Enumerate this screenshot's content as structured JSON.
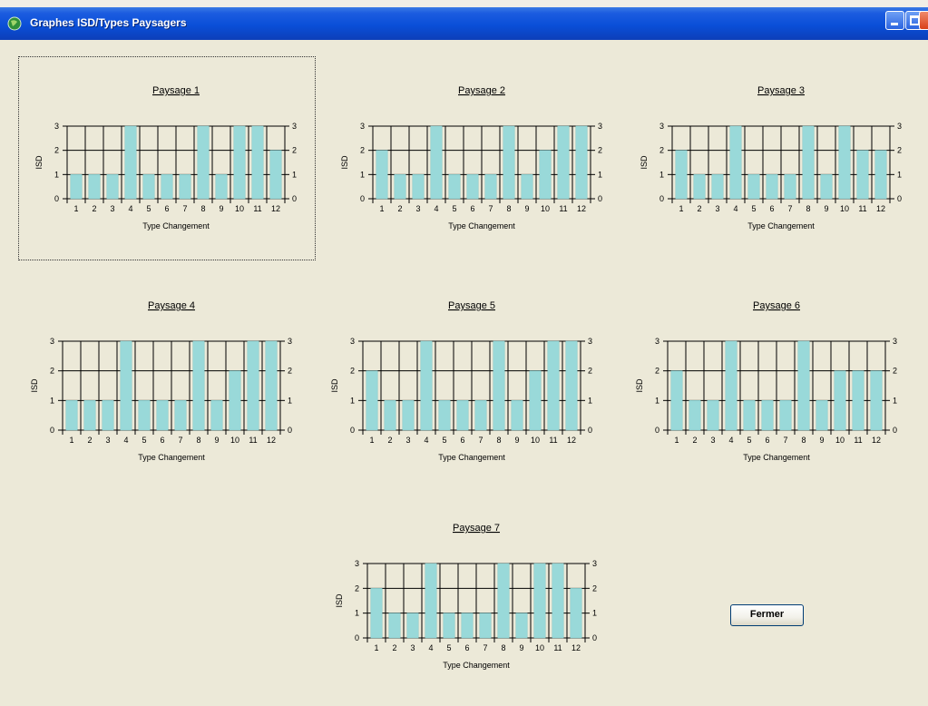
{
  "window": {
    "title": "Graphes ISD/Types Paysagers"
  },
  "buttons": {
    "close_label": "Fermer"
  },
  "colors": {
    "bar": "#99d9d9",
    "bar_edge": "#7fc6c6",
    "titlebar": "#0a4fd8",
    "background": "#ece9d8"
  },
  "chart_data": [
    {
      "type": "bar",
      "title": "Paysage 1",
      "xlabel": "Type Changement",
      "ylabel": "ISD",
      "categories": [
        "1",
        "2",
        "3",
        "4",
        "5",
        "6",
        "7",
        "8",
        "9",
        "10",
        "11",
        "12"
      ],
      "values": [
        1,
        1,
        1,
        3,
        1,
        1,
        1,
        3,
        1,
        3,
        3,
        2
      ],
      "ylim": [
        0,
        3
      ],
      "yticks": [
        0,
        1,
        2,
        3
      ],
      "grid": true,
      "secondary_axis": "right"
    },
    {
      "type": "bar",
      "title": "Paysage 2",
      "xlabel": "Type Changement",
      "ylabel": "ISD",
      "categories": [
        "1",
        "2",
        "3",
        "4",
        "5",
        "6",
        "7",
        "8",
        "9",
        "10",
        "11",
        "12"
      ],
      "values": [
        2,
        1,
        1,
        3,
        1,
        1,
        1,
        3,
        1,
        2,
        3,
        3
      ],
      "ylim": [
        0,
        3
      ],
      "yticks": [
        0,
        1,
        2,
        3
      ],
      "grid": true,
      "secondary_axis": "right"
    },
    {
      "type": "bar",
      "title": "Paysage 3",
      "xlabel": "Type Changement",
      "ylabel": "ISD",
      "categories": [
        "1",
        "2",
        "3",
        "4",
        "5",
        "6",
        "7",
        "8",
        "9",
        "10",
        "11",
        "12"
      ],
      "values": [
        2,
        1,
        1,
        3,
        1,
        1,
        1,
        3,
        1,
        3,
        2,
        2
      ],
      "ylim": [
        0,
        3
      ],
      "yticks": [
        0,
        1,
        2,
        3
      ],
      "grid": true,
      "secondary_axis": "right"
    },
    {
      "type": "bar",
      "title": "Paysage 4",
      "xlabel": "Type Changement",
      "ylabel": "ISD",
      "categories": [
        "1",
        "2",
        "3",
        "4",
        "5",
        "6",
        "7",
        "8",
        "9",
        "10",
        "11",
        "12"
      ],
      "values": [
        1,
        1,
        1,
        3,
        1,
        1,
        1,
        3,
        1,
        2,
        3,
        3
      ],
      "ylim": [
        0,
        3
      ],
      "yticks": [
        0,
        1,
        2,
        3
      ],
      "grid": true,
      "secondary_axis": "right"
    },
    {
      "type": "bar",
      "title": "Paysage 5",
      "xlabel": "Type Changement",
      "ylabel": "ISD",
      "categories": [
        "1",
        "2",
        "3",
        "4",
        "5",
        "6",
        "7",
        "8",
        "9",
        "10",
        "11",
        "12"
      ],
      "values": [
        2,
        1,
        1,
        3,
        1,
        1,
        1,
        3,
        1,
        2,
        3,
        3
      ],
      "ylim": [
        0,
        3
      ],
      "yticks": [
        0,
        1,
        2,
        3
      ],
      "grid": true,
      "secondary_axis": "right"
    },
    {
      "type": "bar",
      "title": "Paysage 6",
      "xlabel": "Type Changement",
      "ylabel": "ISD",
      "categories": [
        "1",
        "2",
        "3",
        "4",
        "5",
        "6",
        "7",
        "8",
        "9",
        "10",
        "11",
        "12"
      ],
      "values": [
        2,
        1,
        1,
        3,
        1,
        1,
        1,
        3,
        1,
        2,
        2,
        2
      ],
      "ylim": [
        0,
        3
      ],
      "yticks": [
        0,
        1,
        2,
        3
      ],
      "grid": true,
      "secondary_axis": "right"
    },
    {
      "type": "bar",
      "title": "Paysage 7",
      "xlabel": "Type Changement",
      "ylabel": "ISD",
      "categories": [
        "1",
        "2",
        "3",
        "4",
        "5",
        "6",
        "7",
        "8",
        "9",
        "10",
        "11",
        "12"
      ],
      "values": [
        2,
        1,
        1,
        3,
        1,
        1,
        1,
        3,
        1,
        3,
        3,
        2
      ],
      "ylim": [
        0,
        3
      ],
      "yticks": [
        0,
        1,
        2,
        3
      ],
      "grid": true,
      "secondary_axis": "right"
    }
  ]
}
